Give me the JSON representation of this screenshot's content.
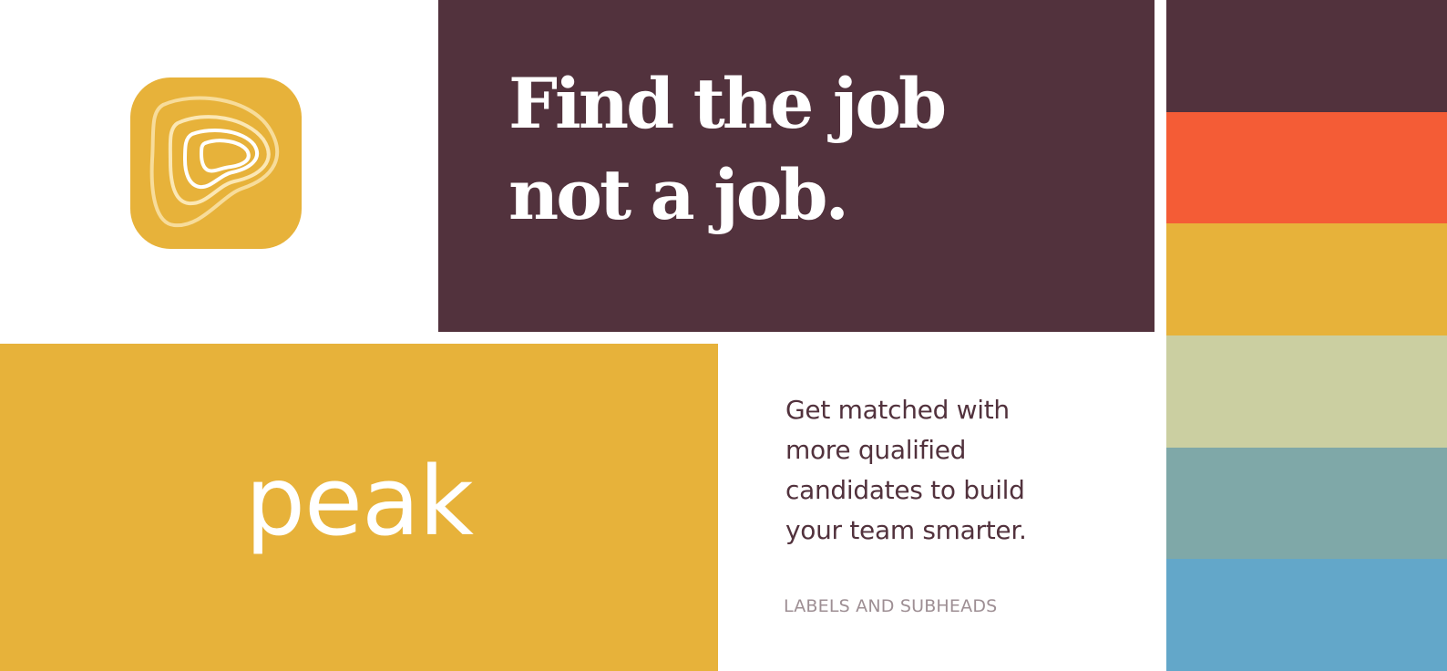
{
  "headline": {
    "line1": "Find the job",
    "line2": "not a job."
  },
  "logo": {
    "wordmark": "peak"
  },
  "tagline": {
    "line1": "Get matched with",
    "line2": "more qualified",
    "line3": "candidates to build",
    "line4": "your team smarter."
  },
  "subhead": {
    "label": "LABELS AND SUBHEADS"
  },
  "app_icon": {
    "name": "contour-topography-icon"
  },
  "colors": {
    "plum": "#52323d",
    "orange": "#f45c36",
    "mustard": "#e7b23a",
    "sage": "#cbcfa1",
    "teal": "#7fa8a8",
    "sky": "#63a7c9",
    "cream": "#f7dc9a",
    "label_gray": "#9e8f94",
    "white": "#ffffff"
  },
  "palette": [
    {
      "name": "plum",
      "hex": "#52323d"
    },
    {
      "name": "orange",
      "hex": "#f45c36"
    },
    {
      "name": "mustard",
      "hex": "#e7b23a"
    },
    {
      "name": "sage",
      "hex": "#cbcfa1"
    },
    {
      "name": "teal",
      "hex": "#7fa8a8"
    },
    {
      "name": "sky",
      "hex": "#63a7c9"
    }
  ]
}
